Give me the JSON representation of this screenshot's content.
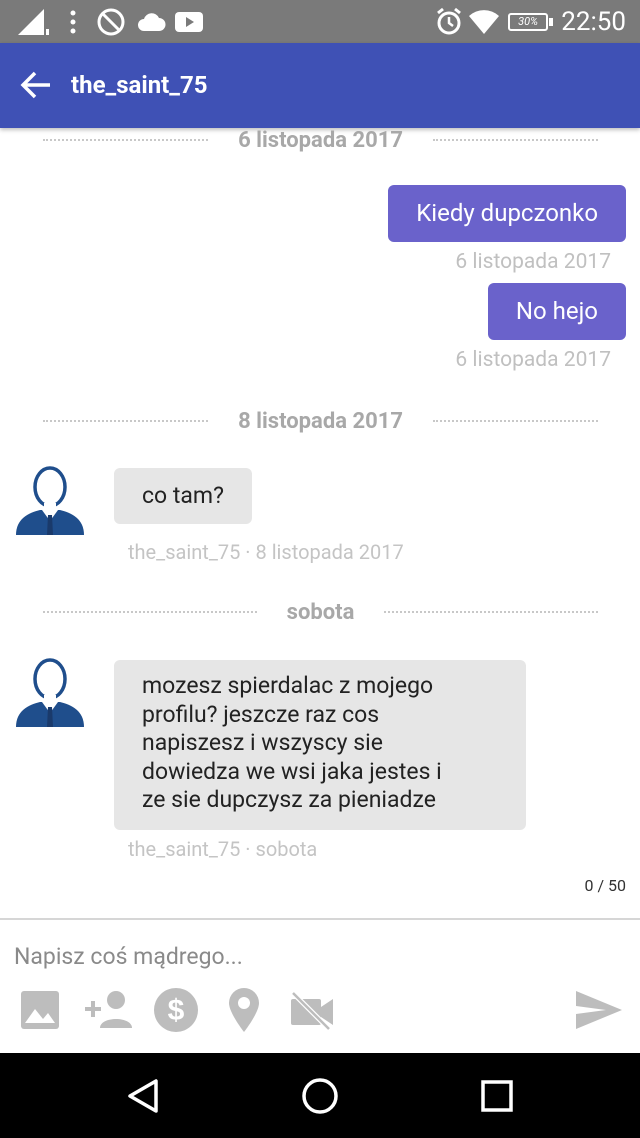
{
  "status_bar": {
    "time": "22:50",
    "battery": "30%",
    "icons": [
      "signal-icon",
      "more-icon",
      "blocked-icon",
      "cloud-icon",
      "youtube-icon",
      "alarm-icon",
      "wifi-icon",
      "battery-icon"
    ]
  },
  "app_bar": {
    "title": "the_saint_75",
    "back_icon": "arrow-back-icon"
  },
  "messages": {
    "date1": "6 listopada 2017",
    "out1": {
      "text": "Kiedy dupczonko",
      "time": "6 listopada 2017"
    },
    "out2": {
      "text": "No hejo",
      "time": "6 listopada 2017"
    },
    "date2": "8 listopada 2017",
    "in1": {
      "text": "co tam?",
      "meta": "the_saint_75 · 8 listopada 2017"
    },
    "date3": "sobota",
    "in2": {
      "lines": [
        "mozesz spierdalac z mojego",
        "profilu? jeszcze raz cos",
        "napiszesz i wszyscy sie",
        "dowiedza we wsi jaka jestes i",
        "ze sie dupczysz za pieniadze"
      ],
      "meta": "the_saint_75 · sobota"
    }
  },
  "composer": {
    "counter": "0 / 50",
    "placeholder": "Napisz coś mądrego...",
    "tools": [
      "image-icon",
      "add-person-icon",
      "dollar-icon",
      "location-icon",
      "video-off-icon"
    ],
    "send_icon": "send-icon"
  },
  "colors": {
    "app_bar": "#3f51b5",
    "outgoing_bubble": "#6a62cb",
    "incoming_bubble": "#e6e6e6",
    "status_bar": "#7a7a7a"
  }
}
